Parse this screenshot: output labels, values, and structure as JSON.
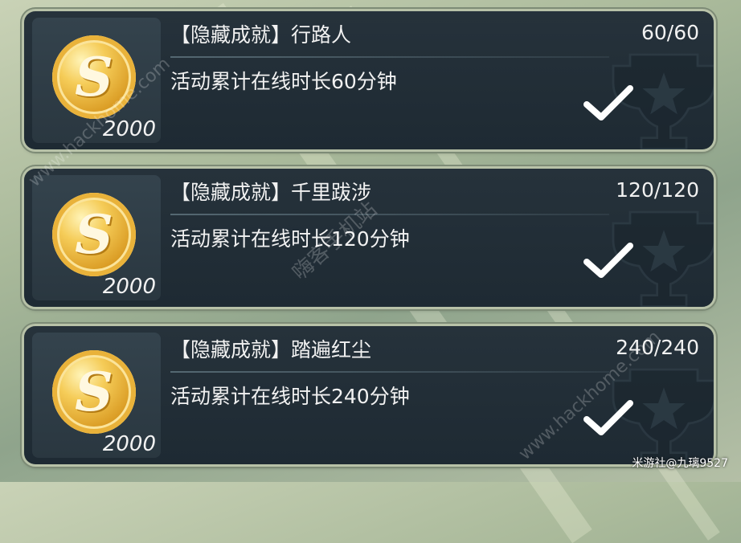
{
  "achievements": [
    {
      "title": "【隐藏成就】行路人",
      "progress": "60/60",
      "description": "活动累计在线时长60分钟",
      "reward_amount": "2000",
      "reward_icon": "gold-coin-s",
      "completed": true
    },
    {
      "title": "【隐藏成就】千里跋涉",
      "progress": "120/120",
      "description": "活动累计在线时长120分钟",
      "reward_amount": "2000",
      "reward_icon": "gold-coin-s",
      "completed": true
    },
    {
      "title": "【隐藏成就】踏遍红尘",
      "progress": "240/240",
      "description": "活动累计在线时长240分钟",
      "reward_amount": "2000",
      "reward_icon": "gold-coin-s",
      "completed": true
    }
  ],
  "coin_glyph": "S",
  "watermark": {
    "text1": "www.hackhome.com",
    "text2": "嗨客手机站",
    "text3": "www.hackhome.com"
  },
  "credit": "米游社@九璃9527",
  "colors": {
    "card_bg": "#222e37",
    "card_border": "#b8c2a8",
    "coin_gold": "#f5cc58",
    "text": "#f1f1f1"
  }
}
